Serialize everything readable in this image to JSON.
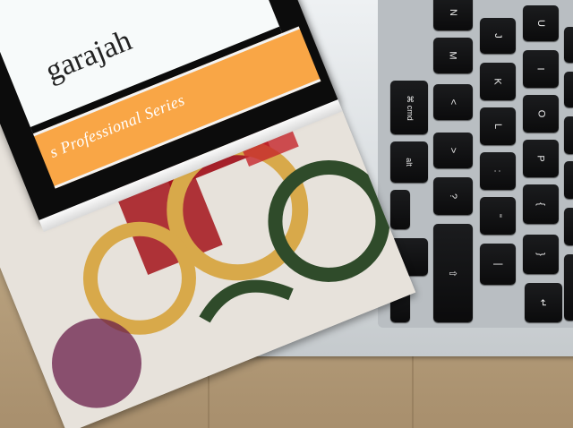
{
  "book_upper": {
    "author_fragment": "garajah",
    "series_fragment": "s Professional Series",
    "colors": {
      "cover": "#0c0c0c",
      "band": "#f9a646",
      "panel": "#f7fafa"
    }
  },
  "keyboard": {
    "keys": [
      {
        "id": "n",
        "label": "N"
      },
      {
        "id": "m",
        "label": "M"
      },
      {
        "id": "comma",
        "label": "<"
      },
      {
        "id": "period",
        "label": ">"
      },
      {
        "id": "slash",
        "label": "?"
      },
      {
        "id": "j",
        "label": "J"
      },
      {
        "id": "k",
        "label": "K"
      },
      {
        "id": "l",
        "label": "L"
      },
      {
        "id": "semicolon",
        "label": ":"
      },
      {
        "id": "quote",
        "label": "\""
      },
      {
        "id": "u",
        "label": "U"
      },
      {
        "id": "i",
        "label": "I"
      },
      {
        "id": "o",
        "label": "O"
      },
      {
        "id": "p",
        "label": "P"
      },
      {
        "id": "bracket_l",
        "label": "{"
      },
      {
        "id": "bracket_r",
        "label": "}"
      },
      {
        "id": "cmd",
        "label": "⌘ cmd"
      },
      {
        "id": "alt",
        "label": "alt"
      },
      {
        "id": "enter",
        "label": "↵"
      },
      {
        "id": "shift",
        "label": "⇧"
      },
      {
        "id": "backslash",
        "label": "|"
      }
    ]
  }
}
